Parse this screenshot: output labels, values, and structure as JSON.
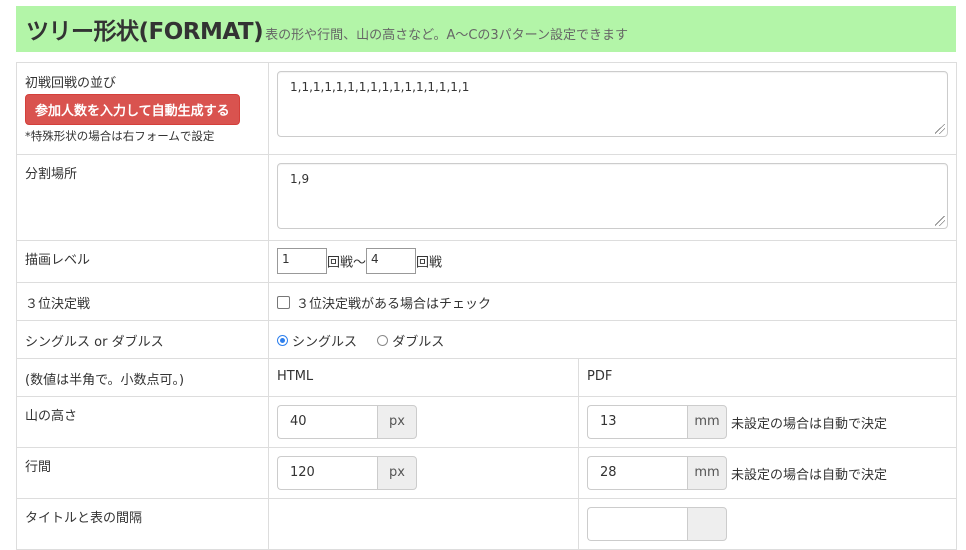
{
  "header": {
    "title": "ツリー形状(FORMAT)",
    "subtitle": "表の形や行間、山の高さなど。A〜Cの3パターン設定できます"
  },
  "rows": {
    "first_round": {
      "label": "初戦回戦の並び",
      "button": "参加人数を入力して自動生成する",
      "note": "*特殊形状の場合は右フォームで設定",
      "value": "1,1,1,1,1,1,1,1,1,1,1,1,1,1,1,1"
    },
    "split": {
      "label": "分割場所",
      "value": "1,9"
    },
    "draw_level": {
      "label": "描画レベル",
      "from": "1",
      "from_unit": "回戦〜",
      "to": "4",
      "to_unit": "回戦"
    },
    "third_place": {
      "label": "３位決定戦",
      "checkbox_label": "３位決定戦がある場合はチェック",
      "checked": false
    },
    "singles_doubles": {
      "label": "シングルス or ダブルス",
      "options": [
        "シングルス",
        "ダブルス"
      ],
      "selected": "シングルス"
    },
    "columns": {
      "label": "(数値は半角で。小数点可。)",
      "html": "HTML",
      "pdf": "PDF"
    },
    "mountain_height": {
      "label": "山の高さ",
      "html_value": "40",
      "html_unit": "px",
      "pdf_value": "13",
      "pdf_unit": "mm",
      "pdf_note": "未設定の場合は自動で決定"
    },
    "line_spacing": {
      "label": "行間",
      "html_value": "120",
      "html_unit": "px",
      "pdf_value": "28",
      "pdf_unit": "mm",
      "pdf_note": "未設定の場合は自動で決定"
    },
    "title_gap": {
      "label": "タイトルと表の間隔"
    }
  },
  "colors": {
    "header_bg": "#b3f5a8",
    "danger_button": "#d9534f",
    "radio_accent": "#2f80ed"
  }
}
